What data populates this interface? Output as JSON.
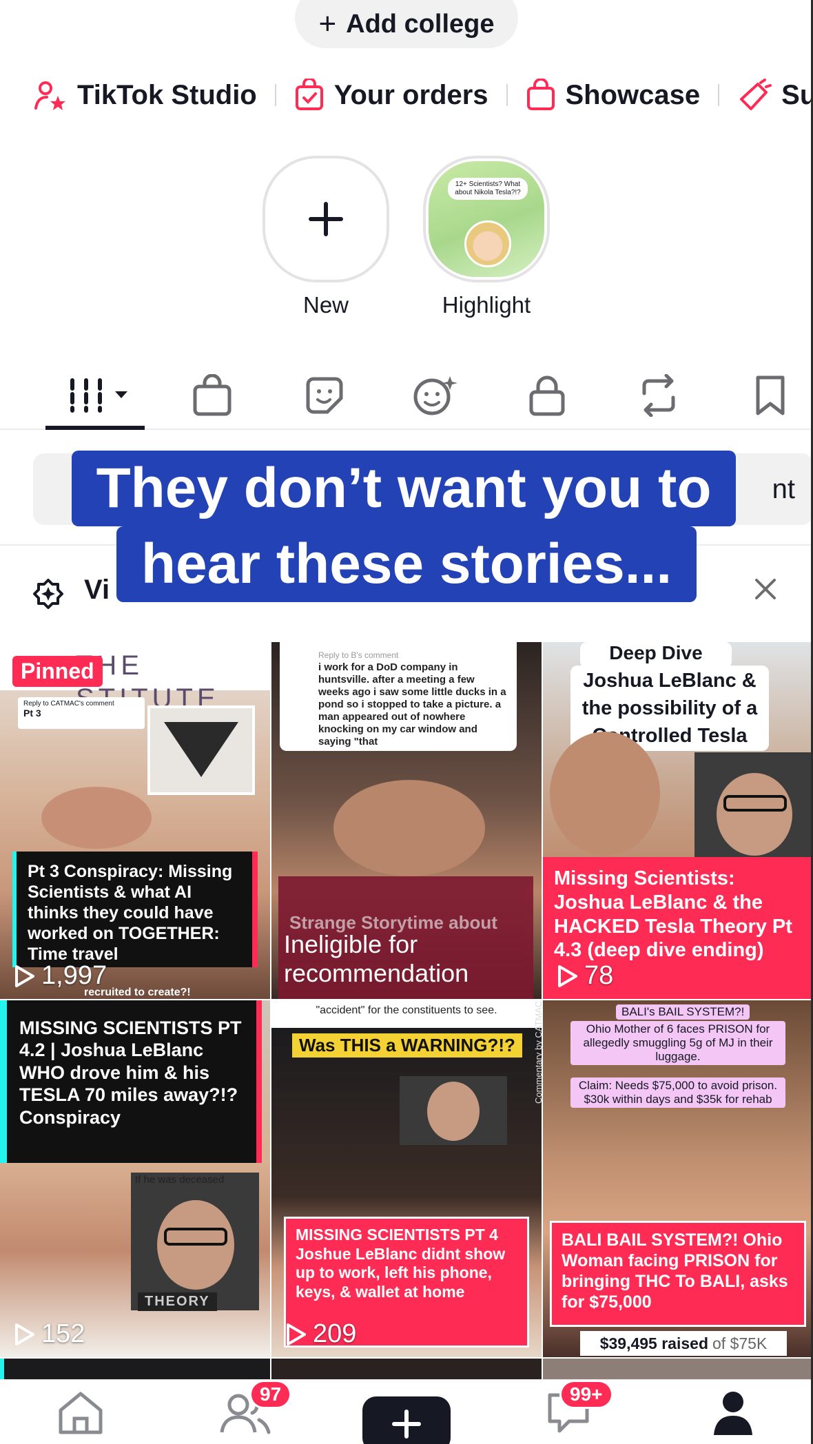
{
  "top": {
    "add_college_label": "Add college"
  },
  "shortcuts": [
    {
      "label": "TikTok Studio",
      "icon": "person-star-icon"
    },
    {
      "label": "Your orders",
      "icon": "order-bag-icon"
    },
    {
      "label": "Showcase",
      "icon": "shopping-bag-icon"
    },
    {
      "label": "Su",
      "icon": "megaphone-icon"
    }
  ],
  "highlights": {
    "new_label": "New",
    "highlight_label": "Highlight",
    "highlight_bubble": "12+ Scientists? What about Nikola Tesla?!?"
  },
  "grey_bar_tail": "nt",
  "caption": {
    "line1": "They don’t want you to",
    "line2": "hear these stories..."
  },
  "notice": {
    "text": "Vi"
  },
  "videos": [
    {
      "pinned": "Pinned",
      "header": "THE  STITUTE",
      "reply": "Reply to CATMAC's comment",
      "reply_sub": "Pt 3",
      "card": "Pt 3 Conspiracy: Missing Scientists & what AI thinks they could have worked on TOGETHER: Time travel",
      "footer": "recruited to create?!",
      "views": "1,997"
    },
    {
      "reply": "Reply to B's comment",
      "story": "i work for a DoD company in huntsville. after a meeting a few weeks ago i saw some little ducks in a pond so i stopped to take a picture. a man appeared out of nowhere knocking on my car window and saying \"that",
      "card": "Strange Storytime about",
      "status": "Ineligible for recommendation"
    },
    {
      "header": "Deep Dive",
      "sub": "Joshua LeBlanc & the possibility of a Controlled Tesla",
      "card": "Missing Scientists: Joshua LeBlanc & the HACKED Tesla Theory Pt 4.3 (deep dive ending)",
      "views": "78"
    },
    {
      "card": "MISSING SCIENTISTS PT 4.2 | Joshua LeBlanc WHO drove him & his TESLA 70 miles away?!? Conspiracy",
      "caption_line": "If he was deceased",
      "tag": "THEORY",
      "views": "152"
    },
    {
      "top_text": "\"accident\" for the constituents to see.",
      "warning": "Was THIS a WARNING?!?",
      "side": "Commentary by CATMAC",
      "card": "MISSING SCIENTISTS PT 4 Joshue LeBlanc didnt show up to work, left his phone, keys, & wallet at home",
      "views": "209"
    },
    {
      "t1": "BALI's BAIL SYSTEM?!",
      "t2": "Ohio Mother of 6 faces PRISON for allegedly smuggling 5g of MJ in their luggage.",
      "t3": "Claim: Needs $75,000 to avoid prison. $30k within days and $35k for rehab",
      "card": "BALI BAIL SYSTEM?! Ohio Woman facing PRISON for bringing THC To BALI, asks for $75,000",
      "raised": "$39,495 raised",
      "raised_of": "of $75K"
    }
  ],
  "bottom_nav": {
    "friends_badge": "97",
    "inbox_badge": "99+"
  },
  "colors": {
    "accent": "#fe2c55",
    "caption_bg": "#2342b6",
    "text": "#161823"
  }
}
